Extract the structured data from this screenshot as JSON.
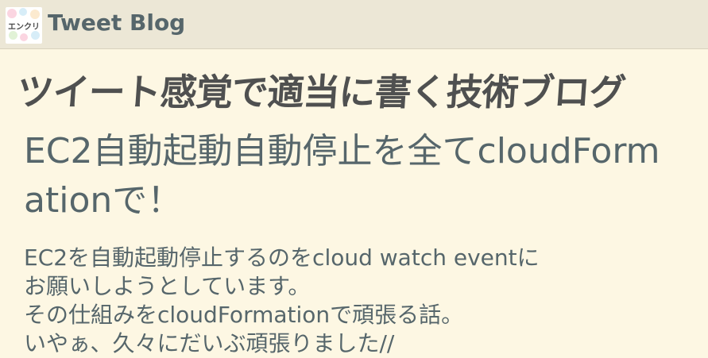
{
  "header": {
    "logo_text": "エンクリ",
    "site_title": "Tweet Blog"
  },
  "tagline": "ツイート感覚で適当に書く技術ブログ",
  "post": {
    "title": "EC2自動起動自動停止を全てcloudFormationで！",
    "excerpt_lines": [
      "EC2を自動起動停止するのをcloud watch eventに",
      "お願いしようとしています。",
      "その仕組みをcloudFormationで頑張る話。",
      "いやぁ、久々にだいぶ頑張りました//"
    ]
  },
  "colors": {
    "page_background": "#fdf7e3",
    "header_background": "#ece7d6",
    "title_color": "#56666b",
    "tagline_color": "#4f5050"
  }
}
